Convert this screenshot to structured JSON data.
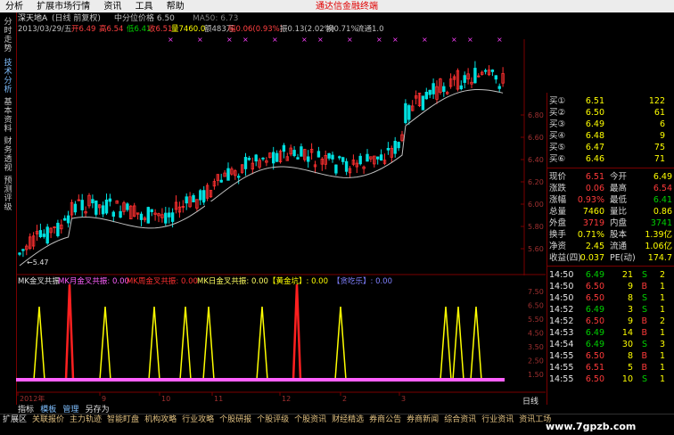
{
  "menu": {
    "items": [
      "分析",
      "扩展市场行情",
      "资讯",
      "工具",
      "帮助"
    ],
    "promo": "通达信金融终端"
  },
  "left_tabs": [
    "分时走势",
    "技术分析",
    "基本资料",
    "财务透视",
    "预测评级"
  ],
  "header": {
    "stock": "深天地A",
    "period": "(日线 前复权)",
    "mid_line": "中分位价格 6.50",
    "ma": "MA50: 6.73",
    "date": "2013/03/29/五",
    "open": "开6.49",
    "high": "高6.54",
    "low": "低6.41",
    "close": "收6.51",
    "volume": "量7460.0",
    "amount": "额483万",
    "change": "幅0.06(0.93%)",
    "amplitude": "振0.13(2.02%)",
    "turnover": "换0.71%",
    "float": "流通1.0"
  },
  "price_axis": [
    "6.80",
    "6.60",
    "6.40",
    "6.20",
    "6.00",
    "5.80",
    "5.60"
  ],
  "low_marker": "←5.47",
  "indicator_header": {
    "name": "MK金叉共振",
    "m1": "MK月金叉共振: 0.00",
    "m2": "MK周金叉共振: 0.00",
    "m3": "MK日金叉共振: 0.00",
    "m4": "【黄金坑】: 0.00",
    "m5": "【贪吃乐】: 0.00"
  },
  "indicator_axis": [
    "7.50",
    "6.50",
    "5.50",
    "4.50",
    "3.50",
    "2.50",
    "1.50"
  ],
  "date_axis": [
    "2012年",
    "9",
    "10",
    "11",
    "12",
    "2",
    "3"
  ],
  "quote": {
    "buy": [
      {
        "label": "买①",
        "price": "6.51",
        "vol": "122"
      },
      {
        "label": "买②",
        "price": "6.50",
        "vol": "61"
      },
      {
        "label": "买③",
        "price": "6.49",
        "vol": "6"
      },
      {
        "label": "买④",
        "price": "6.48",
        "vol": "9"
      },
      {
        "label": "买⑤",
        "price": "6.47",
        "vol": "75"
      },
      {
        "label": "买⑥",
        "price": "6.46",
        "vol": "71"
      }
    ],
    "stats": [
      {
        "l1": "现价",
        "v1": "6.51",
        "l2": "今开",
        "v2": "6.49"
      },
      {
        "l1": "涨跌",
        "v1": "0.06",
        "l2": "最高",
        "v2": "6.54"
      },
      {
        "l1": "涨幅",
        "v1": "0.93%",
        "l2": "最低",
        "v2": "6.41"
      },
      {
        "l1": "总量",
        "v1": "7460",
        "l2": "量比",
        "v2": "0.86"
      },
      {
        "l1": "外盘",
        "v1": "3719",
        "l2": "内盘",
        "v2": "3741"
      },
      {
        "l1": "换手",
        "v1": "0.71%",
        "l2": "股本",
        "v2": "1.39亿"
      },
      {
        "l1": "净资",
        "v1": "2.45",
        "l2": "流通",
        "v2": "1.06亿"
      },
      {
        "l1": "收益(四)",
        "v1": "0.037",
        "l2": "PE(动)",
        "v2": "174.7"
      }
    ],
    "ticks": [
      {
        "t": "14:50",
        "p": "6.49",
        "v": "21",
        "d": "S",
        "n": "2"
      },
      {
        "t": "14:50",
        "p": "6.50",
        "v": "9",
        "d": "B",
        "n": "1"
      },
      {
        "t": "14:50",
        "p": "6.50",
        "v": "8",
        "d": "S",
        "n": "1"
      },
      {
        "t": "14:52",
        "p": "6.49",
        "v": "3",
        "d": "S",
        "n": "1"
      },
      {
        "t": "14:52",
        "p": "6.50",
        "v": "9",
        "d": "B",
        "n": "2"
      },
      {
        "t": "14:53",
        "p": "6.49",
        "v": "14",
        "d": "B",
        "n": "1"
      },
      {
        "t": "14:54",
        "p": "6.49",
        "v": "30",
        "d": "S",
        "n": "3"
      },
      {
        "t": "14:55",
        "p": "6.50",
        "v": "8",
        "d": "B",
        "n": "1"
      },
      {
        "t": "14:55",
        "p": "6.51",
        "v": "5",
        "d": "B",
        "n": "1"
      },
      {
        "t": "14:55",
        "p": "6.50",
        "v": "10",
        "d": "S",
        "n": "1"
      }
    ]
  },
  "bottom_tabs": [
    "指标",
    "模板",
    "管理",
    "另存为"
  ],
  "bottom_right": "日线",
  "bottom_bar": [
    "扩展区",
    "关联报价",
    "主力轨迹",
    "智能盯盘",
    "机构攻略",
    "行业攻略",
    "个股研报",
    "个股评级",
    "个股资讯",
    "财经精选",
    "券商公告",
    "券商新闻",
    "综合资讯",
    "行业资讯",
    "资讯工场"
  ],
  "watermark": "www.7gpzb.com"
}
